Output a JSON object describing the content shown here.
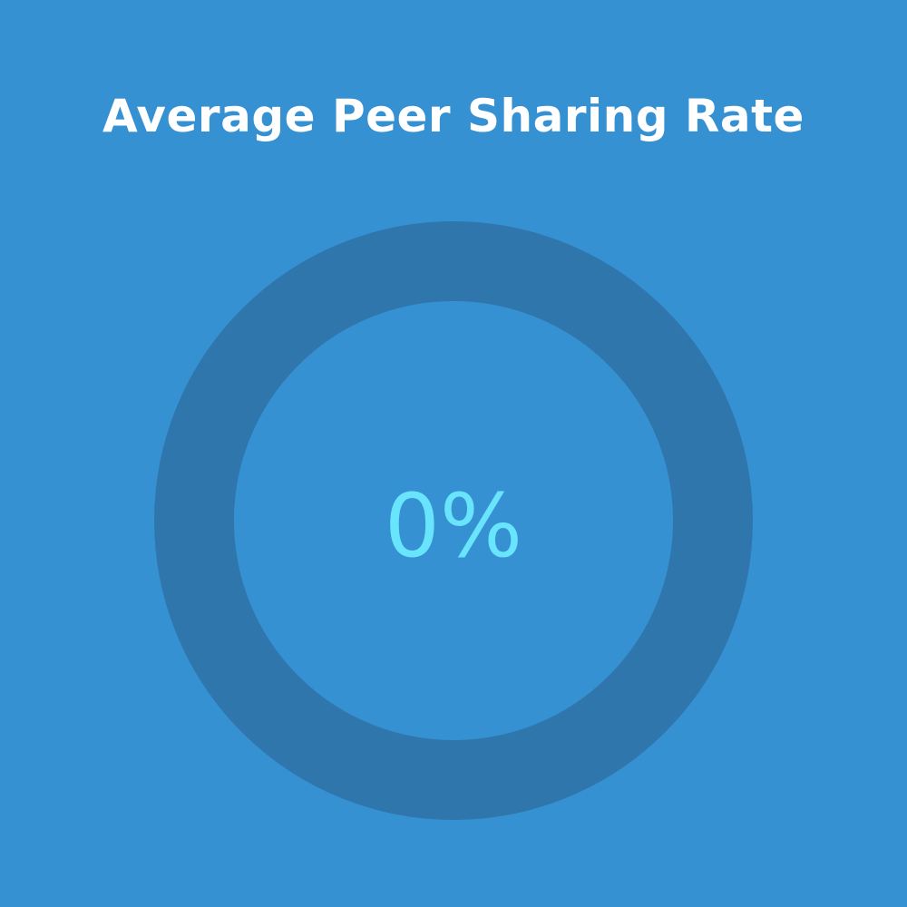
{
  "title": "Average Peer Sharing Rate",
  "chart_data": {
    "type": "pie",
    "title": "Average Peer Sharing Rate",
    "value_label": "0%",
    "value": 0,
    "max": 100,
    "colors": {
      "background": "#3691d3",
      "track": "#2f76ad",
      "fill": "#69e4fd",
      "label": "#69e4fd",
      "title": "#ffffff"
    }
  }
}
